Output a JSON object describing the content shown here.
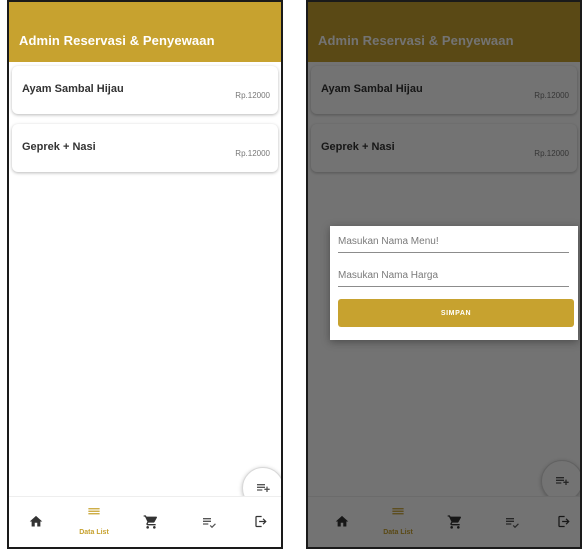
{
  "colors": {
    "primary": "#c7a22f",
    "background": "#ffffff",
    "scrim": "rgba(0,0,0,0.55)"
  },
  "app": {
    "title": "Admin Reservasi & Penyewaan"
  },
  "menu_items": [
    {
      "name": "Ayam Sambal Hijau",
      "price": "Rp.12000"
    },
    {
      "name": "Geprek + Nasi",
      "price": "Rp.12000"
    }
  ],
  "fab": {
    "icon": "playlist-add-icon"
  },
  "bottom_nav": {
    "active": "data-list",
    "items": [
      {
        "id": "home",
        "icon": "home-icon",
        "label": ""
      },
      {
        "id": "data-list",
        "icon": "list-icon",
        "label": "Data List"
      },
      {
        "id": "cart",
        "icon": "cart-icon",
        "label": ""
      },
      {
        "id": "checklist",
        "icon": "playlist-check-icon",
        "label": ""
      },
      {
        "id": "logout",
        "icon": "logout-icon",
        "label": ""
      }
    ]
  },
  "dialog": {
    "menu_placeholder": "Masukan Nama Menu!",
    "price_placeholder": "Masukan Nama Harga",
    "save_label": "SIMPAN"
  }
}
